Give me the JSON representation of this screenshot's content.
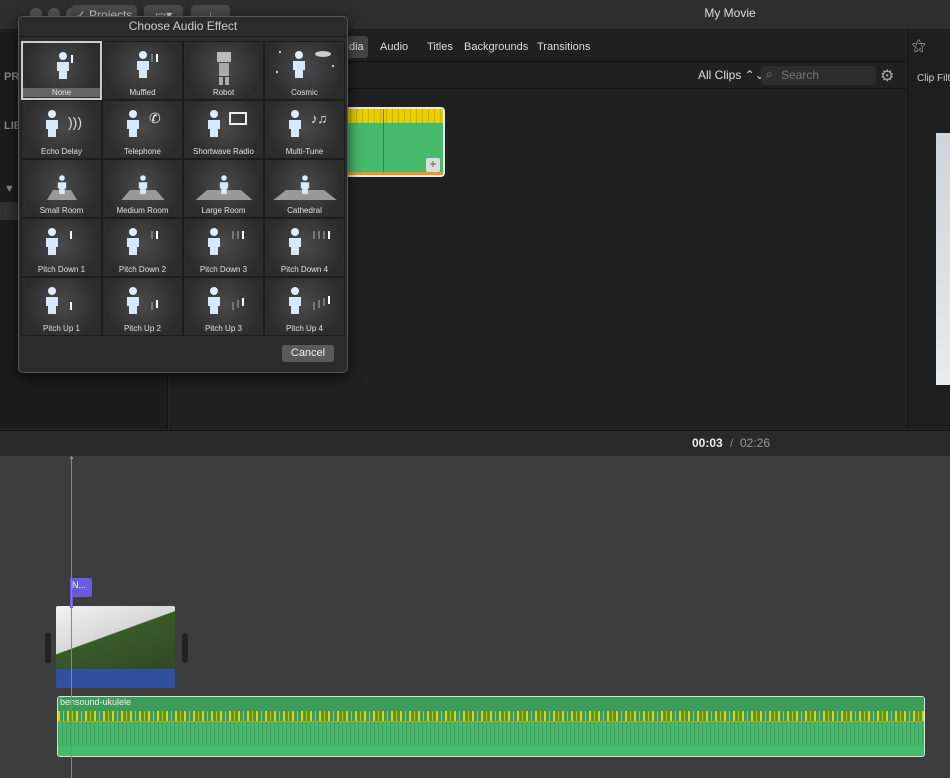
{
  "window": {
    "title": "My Movie",
    "projects_button": "✓ Projects"
  },
  "tabs": [
    {
      "label": "dia",
      "active": true
    },
    {
      "label": "Audio"
    },
    {
      "label": "Titles"
    },
    {
      "label": "Backgrounds"
    },
    {
      "label": "Transitions"
    }
  ],
  "sidebar": {
    "labels": [
      "PR",
      "LIB",
      "▼ i"
    ]
  },
  "browser": {
    "filter": "All Clips ⌃⌄",
    "search_placeholder": "Search"
  },
  "right_panel": {
    "label": "Clip Filt"
  },
  "viewer": {
    "current": "00:03",
    "separator": "/",
    "total": "02:26"
  },
  "dialog": {
    "title": "Choose Audio Effect",
    "cancel": "Cancel",
    "selected": "None",
    "effects": [
      {
        "label": "None",
        "icon": "person-icon"
      },
      {
        "label": "Muffled",
        "icon": "muffled-person-icon"
      },
      {
        "label": "Robot",
        "icon": "robot-icon"
      },
      {
        "label": "Cosmic",
        "icon": "astronaut-ufo-icon"
      },
      {
        "label": "Echo Delay",
        "icon": "echo-icon"
      },
      {
        "label": "Telephone",
        "icon": "telephone-icon"
      },
      {
        "label": "Shortwave Radio",
        "icon": "radio-icon"
      },
      {
        "label": "Multi-Tune",
        "icon": "music-notes-icon"
      },
      {
        "label": "Small Room",
        "icon": "small-room-icon"
      },
      {
        "label": "Medium Room",
        "icon": "medium-room-icon"
      },
      {
        "label": "Large Room",
        "icon": "large-room-icon"
      },
      {
        "label": "Cathedral",
        "icon": "cathedral-icon"
      },
      {
        "label": "Pitch Down 1",
        "icon": "pitch-down-icon"
      },
      {
        "label": "Pitch Down 2",
        "icon": "pitch-down-icon"
      },
      {
        "label": "Pitch Down 3",
        "icon": "pitch-down-icon"
      },
      {
        "label": "Pitch Down 4",
        "icon": "pitch-down-icon"
      },
      {
        "label": "Pitch Up 1",
        "icon": "pitch-up-icon"
      },
      {
        "label": "Pitch Up 2",
        "icon": "pitch-up-icon"
      },
      {
        "label": "Pitch Up 3",
        "icon": "pitch-up-icon"
      },
      {
        "label": "Pitch Up 4",
        "icon": "pitch-up-icon"
      }
    ]
  },
  "timeline": {
    "title_marker": "N...",
    "audio_clip": "bensound-ukulele"
  },
  "colors": {
    "audio_green": "#47b96a",
    "waveform_yellow": "#e8d000",
    "video_blue": "#3350a0",
    "marker_purple": "#6a5ae0"
  }
}
